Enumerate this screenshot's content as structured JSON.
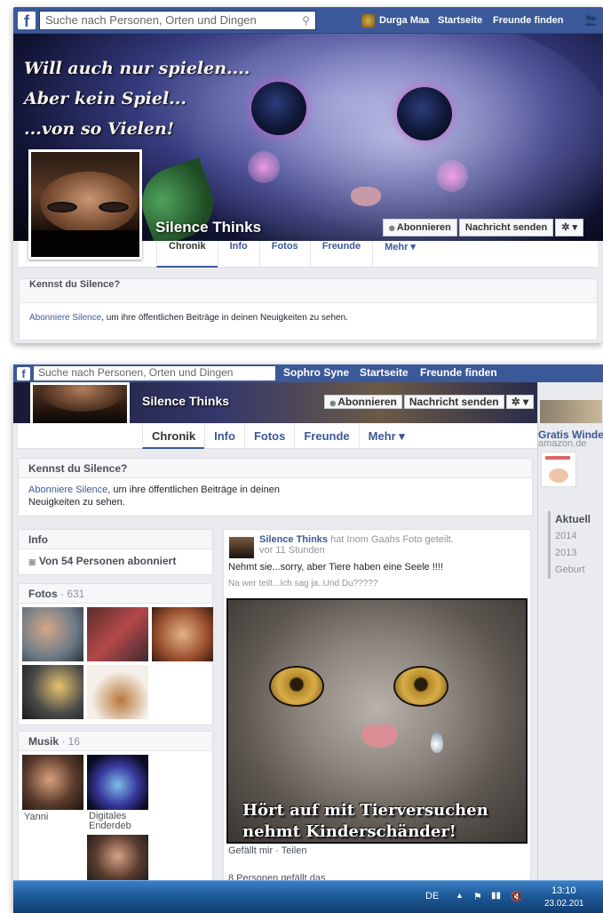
{
  "shot1": {
    "search_placeholder": "Suche nach Personen, Orten und Dingen",
    "nav_user": "Durga Maa",
    "nav_home": "Startseite",
    "nav_find_friends": "Freunde finden",
    "cover_lines": [
      "Will auch nur spielen....",
      "Aber kein Spiel...",
      "...von so Vielen!"
    ],
    "profile_name": "Silence Thinks",
    "subscribe_label": "Abonnieren",
    "message_label": "Nachricht senden",
    "gear_label": "✲ ▾",
    "tabs": [
      "Chronik",
      "Info",
      "Fotos",
      "Freunde",
      "Mehr ▾"
    ],
    "know_title": "Kennst du Silence?",
    "know_link": "Abonniere Silence",
    "know_text": ", um ihre öffentlichen Beiträge in deinen Neuigkeiten zu sehen."
  },
  "shot2": {
    "search_placeholder": "Suche nach Personen, Orten und Dingen",
    "nav_user": "Sophro Syne",
    "nav_home": "Startseite",
    "nav_find_friends": "Freunde finden",
    "profile_name": "Silence Thinks",
    "subscribe_label": "Abonnieren",
    "message_label": "Nachricht senden",
    "gear_label": "✲ ▾",
    "tabs": [
      "Chronik",
      "Info",
      "Fotos",
      "Freunde",
      "Mehr ▾"
    ],
    "know_title": "Kennst du Silence?",
    "know_link": "Abonniere Silence",
    "know_text_1": ", um ihre öffentlichen Beiträge in deinen",
    "know_text_2": "Neuigkeiten zu sehen.",
    "info_title": "Info",
    "info_followers": "Von 54 Personen abonniert",
    "photos_title": "Fotos",
    "photos_count": " · 631",
    "music_title": "Musik",
    "music_count": " · 16",
    "music_items": [
      "Yanni",
      "Digitales Enderdeb"
    ],
    "post": {
      "author": "Silence Thinks",
      "shared_text": " hat Inom Gaahs Foto geteilt.",
      "time": "vor 11 Stunden",
      "text_line1": "Nehmt sie...sorry, aber Tiere haben eine Seele !!!!",
      "text_line2": "Na wer teilt...Ich sag ja..Und Du?????",
      "caption_line1": "Hört auf mit Tierversuchen",
      "caption_line2": "nehmt Kinderschänder!",
      "actions": "Gefällt mir · Teilen",
      "likes": "8 Personen gefällt das."
    },
    "ad_title": "Gratis Winde",
    "ad_domain": "amazon.de",
    "timeline": [
      "Aktuell",
      "2014",
      "2013",
      "Geburt"
    ],
    "taskbar": {
      "lang": "DE",
      "time": "13:10",
      "date": "23.02.201"
    }
  }
}
